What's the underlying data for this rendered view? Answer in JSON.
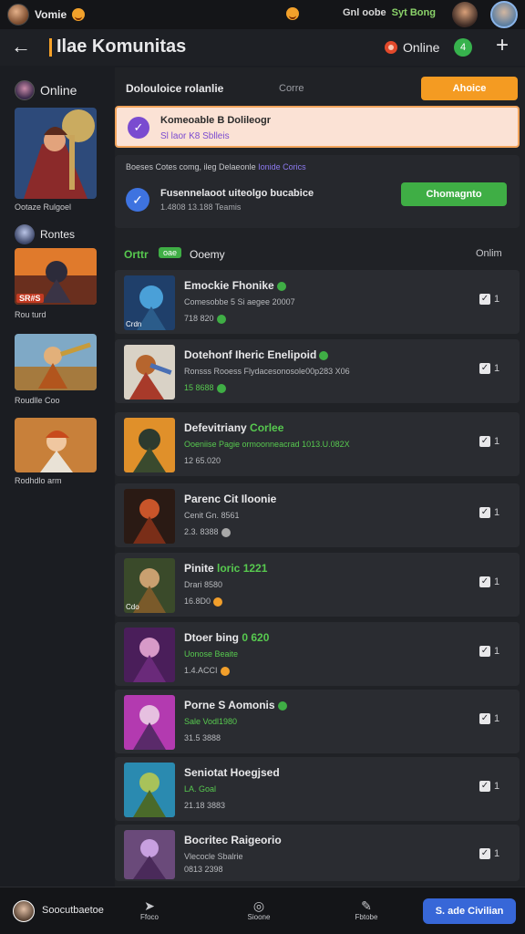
{
  "status_bar": {
    "user": "Vomie",
    "center_text": "Gnl oobe",
    "right_text": "Syt Bong"
  },
  "app_bar": {
    "title": "Ilae Komunitas",
    "online_label": "Online",
    "badge": "4"
  },
  "sidebar": {
    "header": "Online",
    "featured_caption": "Ootaze Rulgoel",
    "section_title": "Rontes",
    "games": [
      {
        "caption": "Rou turd",
        "tag": "SR#S"
      },
      {
        "caption": "Roudlle Coo"
      },
      {
        "caption": "Rodhdlo arm"
      }
    ]
  },
  "main": {
    "filter_label": "Dolouloice rolanlie",
    "filter_dim": "Corre",
    "filter_button": "Ahoice",
    "notice": {
      "title": "Komeoable B Dolileogr",
      "subtitle": "Sl laor K8 Sblleis"
    },
    "invite": {
      "head_prefix": "Boeses Cotes comg, ileg Delaeonle",
      "head_highlight": "Ionide Corics",
      "title": "Fusennelaoot uiteolgo bucabice",
      "subtitle": "1.4808 13.188 Teamis",
      "button": "Chomagnto"
    },
    "list_head": {
      "a": "Orttr",
      "pill": "oae",
      "b": "Ooemy",
      "right": "Onlim"
    },
    "items": [
      {
        "name": "Emockie Fhonike",
        "sub": "Comesobbe 5 Si aegee 20007",
        "meta": "718 820",
        "count": "1",
        "tag": "Crdn"
      },
      {
        "name": "Dotehonf Iheric Enelipoid",
        "sub": "Ronsss Rooess Flydacesonosole00p283 X06",
        "meta": "15 8688",
        "count": "1",
        "tag": ""
      },
      {
        "name": "Defevitriany",
        "name_g": "Corlee",
        "sub": "Ooeniise Pagie ormoonneacrad 1013.U.082X",
        "meta": "12 65.020",
        "count": "1",
        "tag": ""
      },
      {
        "name": "Parenc Cit Iloonie",
        "sub": "Cenit Gn. 8561",
        "meta": "2.3. 8388",
        "count": "1",
        "tag": ""
      },
      {
        "name": "Pinite",
        "name_g": "loric 1221",
        "sub": "Drari 8580",
        "meta": "16.8D0",
        "count": "1",
        "tag": "Cdo"
      },
      {
        "name": "Dtoer bing",
        "name_g": "0 620",
        "sub": "Uonose Beaite",
        "meta": "1.4.ACCI",
        "count": "1",
        "tag": ""
      },
      {
        "name": "Porne S Aomonis",
        "sub": "Sale Vodl1980",
        "meta": "31.5 3888",
        "count": "1",
        "tag": ""
      },
      {
        "name": "Seniotat Hoegjsed",
        "sub": "LA. Goal",
        "meta": "21.18 3883",
        "count": "1",
        "tag": ""
      },
      {
        "name": "Bocritec Raigeorio",
        "sub": "Vlecocle Sbalrie",
        "meta": "0813 2398",
        "count": "1",
        "tag": ""
      }
    ]
  },
  "bottom_bar": {
    "user": "Soocutbaetoe",
    "tabs": [
      "Ffoco",
      "Sioone",
      "Fbtobe"
    ],
    "button": "S. ade Civilian"
  },
  "colors": {
    "accent_orange": "#f49b22",
    "accent_green": "#3fae45",
    "accent_blue": "#3767d8",
    "accent_purple": "#7a4bd0"
  }
}
